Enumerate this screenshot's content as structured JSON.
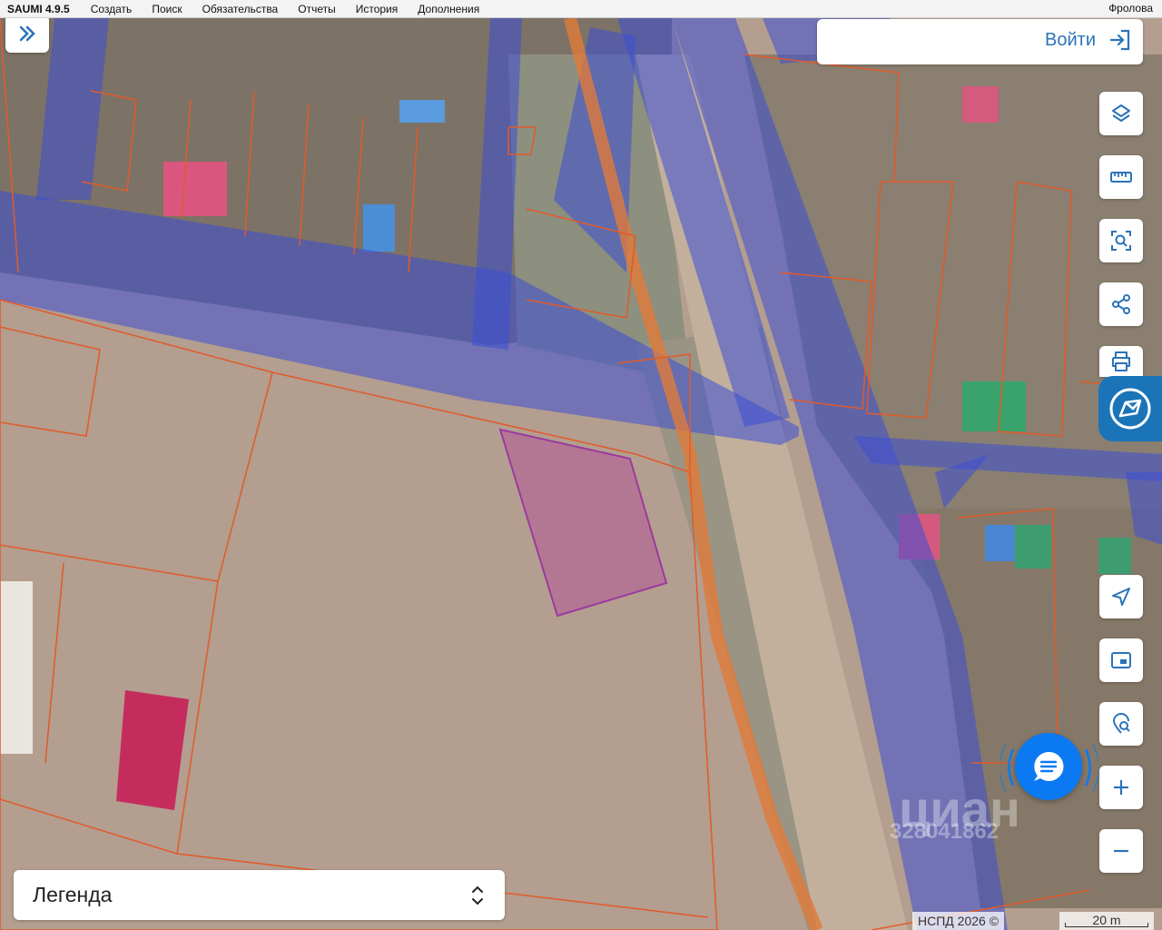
{
  "menubar": {
    "app": "SAUMI 4.9.5",
    "items": [
      "Создать",
      "Поиск",
      "Обязательства",
      "Отчеты",
      "История",
      "Дополнения"
    ],
    "user": "Фролова"
  },
  "login": {
    "label": "Войти"
  },
  "legend": {
    "label": "Легенда"
  },
  "footer": {
    "copyright": "НСПД 2026 ©",
    "scale": "20 m"
  },
  "watermark": {
    "brand": "циан",
    "number": "328041862"
  },
  "icons": {
    "expand": "double-chevron-right-icon",
    "login": "login-arrow-icon",
    "layers": "layers-icon",
    "ruler": "ruler-icon",
    "select": "area-search-icon",
    "share": "share-icon",
    "print": "printer-icon",
    "locate": "navigation-arrow-icon",
    "minimap": "minimap-icon",
    "search-map": "map-search-icon",
    "zoom-in": "plus-icon",
    "zoom-out": "minus-icon",
    "chat": "chat-icon"
  },
  "colors": {
    "accent": "#2b73b8",
    "chat": "#0b79f1",
    "sidetab": "#1c74b8",
    "parcel": "#9b3aa0",
    "zone": "#3c4fd6",
    "boundary": "#e25a2a"
  }
}
